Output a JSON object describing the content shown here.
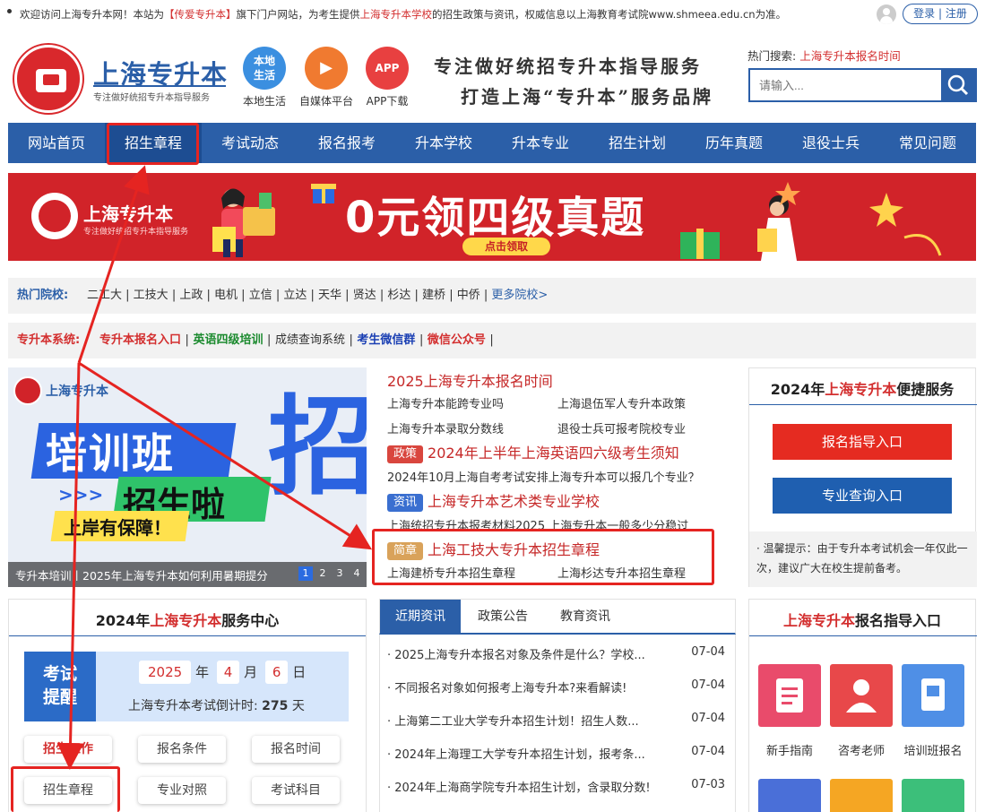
{
  "topbar": {
    "notice_pre": "欢迎访问上海专升本网！本站为",
    "notice_brand": "【传爱专升本】",
    "notice_mid": "旗下门户网站，为考生提供",
    "notice_link": "上海专升本学校",
    "notice_post": "的招生政策与资讯，权威信息以上海教育考试院www.shmeea.edu.cn为准。",
    "login": "登录",
    "register": "注册",
    "sep": "|"
  },
  "header": {
    "site_name": "上海专升本",
    "site_tagline": "专注做好统招专升本指导服务",
    "apps": [
      {
        "icon": "本地\n生活",
        "label": "本地生活"
      },
      {
        "icon": "▶",
        "label": "自媒体平台"
      },
      {
        "icon": "APP",
        "label": "APP下载"
      }
    ],
    "slogan1": "专注做好统招专升本指导服务",
    "slogan2": "打造上海“专升本”服务品牌",
    "hot_label": "热门搜索:",
    "hot_link": "上海专升本报名时间",
    "search_placeholder": "请输入..."
  },
  "nav": [
    "网站首页",
    "招生章程",
    "考试动态",
    "报名报考",
    "升本学校",
    "升本专业",
    "招生计划",
    "历年真题",
    "退役士兵",
    "常见问题"
  ],
  "banner": {
    "brand": "上海专升本",
    "brand_sub": "专注做好统招专升本指导服务",
    "headline": "0元领四级真题",
    "cta": "点击领取"
  },
  "hot_schools": {
    "label": "热门院校:",
    "items": [
      "二工大",
      "工技大",
      "上政",
      "电机",
      "立信",
      "立达",
      "天华",
      "贤达",
      "杉达",
      "建桥",
      "中侨"
    ],
    "more": "更多院校>"
  },
  "systems": {
    "label": "专升本系统:",
    "items": [
      {
        "text": "专升本报名入口",
        "color": "#d32f2f"
      },
      {
        "text": "英语四级培训",
        "color": "#1b8a2e"
      },
      {
        "text": "成绩查询系统",
        "color": "#333333"
      },
      {
        "text": "考生微信群",
        "color": "#1a3fb3"
      },
      {
        "text": "微信公众号",
        "color": "#d32f2f"
      }
    ]
  },
  "promo": {
    "brand": "上海专升本",
    "line1": "培训班",
    "line2": "招生啦",
    "line3": "上岸有保障！",
    "big": "招",
    "caption": "专升本培训丨2025年上海专升本如何利用暑期提分",
    "pages": [
      "1",
      "2",
      "3",
      "4"
    ]
  },
  "news": {
    "headline": "2025上海专升本报名时间",
    "rows": [
      [
        "上海专升本能跨专业吗",
        "上海退伍军人专升本政策"
      ],
      [
        "上海专升本录取分数线",
        "退役士兵可报考院校专业"
      ]
    ],
    "tag1": "政策",
    "tag1_title": "2024年上半年上海英语四六级考生须知",
    "line2": "2024年10月上海自考考试安排上海专升本可以报几个专业？",
    "tag2": "资讯",
    "tag2_title": "上海专升本艺术类专业学校",
    "line3": "上海统招专升本报考材料2025 上海专升本一般多少分稳过",
    "tag3": "简章",
    "tag3_title": "上海工技大专升本招生章程",
    "row_last": [
      "上海建桥专升本招生章程",
      "上海杉达专升本招生章程"
    ]
  },
  "quick": {
    "title_pre": "2024年",
    "title_red": "上海专升本",
    "title_post": "便捷服务",
    "btn1": "报名指导入口",
    "btn2": "专业查询入口",
    "tip": "· 温馨提示：由于专升本考试机会一年仅此一次，建议广大在校生提前备考。"
  },
  "service": {
    "title_pre": "2024年",
    "title_red": "上海专升本",
    "title_post": "服务中心",
    "exam_label": "考试提醒",
    "year": "2025",
    "year_unit": "年",
    "month": "4",
    "month_unit": "月",
    "day": "6",
    "day_unit": "日",
    "countdown_pre": "上海专升本考试倒计时:",
    "countdown_num": "275",
    "countdown_unit": "天",
    "buttons": [
      "招生工作",
      "报名条件",
      "报名时间",
      "招生章程",
      "专业对照",
      "考试科目"
    ]
  },
  "tabs": {
    "items": [
      "近期资讯",
      "政策公告",
      "教育资讯"
    ],
    "list": [
      {
        "t": "· 2025上海专升本报名对象及条件是什么？学校...",
        "d": "07-04"
      },
      {
        "t": "· 不同报名对象如何报考上海专升本?来看解读!",
        "d": "07-04"
      },
      {
        "t": "· 上海第二工业大学专升本招生计划！招生人数...",
        "d": "07-04"
      },
      {
        "t": "· 2024年上海理工大学专升本招生计划，报考条...",
        "d": "07-04"
      },
      {
        "t": "· 2024年上海商学院专升本招生计划，含录取分数!",
        "d": "07-03"
      }
    ]
  },
  "guide": {
    "title_red": "上海专升本",
    "title_post": "报名指导入口",
    "items": [
      {
        "label": "新手指南",
        "color": "#e94b6b"
      },
      {
        "label": "咨考老师",
        "color": "#e8484a"
      },
      {
        "label": "培训班报名",
        "color": "#4f8fe6"
      }
    ],
    "row2_colors": [
      "#4a6fd8",
      "#f5a623",
      "#3cbf7a"
    ]
  },
  "colors": {
    "brand_blue": "#2b5fa8",
    "accent_red": "#d32f2f",
    "highlight": "#e52421"
  }
}
